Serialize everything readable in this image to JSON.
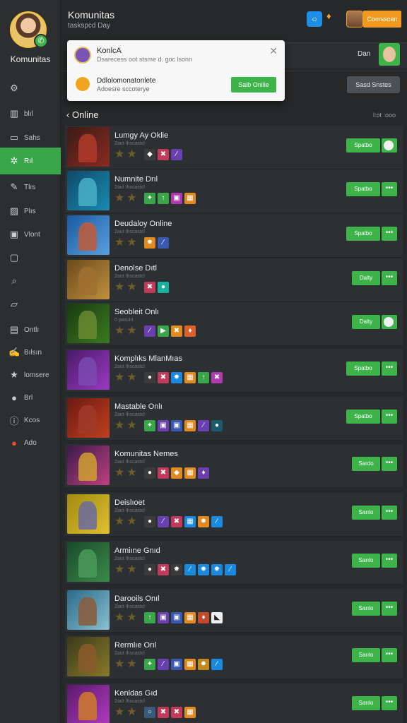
{
  "app": {
    "title": "Komunitas",
    "subtitle": "taskspcd Day",
    "header_action_label": "Comssoan"
  },
  "sidebar": {
    "title": "Komunitas",
    "items": [
      {
        "label": "",
        "icon": "settings-icon"
      },
      {
        "label": "blıl",
        "icon": "chart-icon"
      },
      {
        "label": "Sahs",
        "icon": "window-icon"
      },
      {
        "label": "Rıl",
        "icon": "star-icon",
        "active": true
      },
      {
        "label": "Tlıs",
        "icon": "pen-icon"
      },
      {
        "label": "Plıs",
        "icon": "image-icon"
      },
      {
        "label": "Vlont",
        "icon": "photo-icon"
      },
      {
        "label": "",
        "icon": "frame-icon"
      },
      {
        "label": "",
        "icon": "search-icon"
      },
      {
        "label": "",
        "icon": "book-icon"
      },
      {
        "label": "Ontlı",
        "icon": "folder-icon"
      },
      {
        "label": "Bılsın",
        "icon": "edit-icon"
      },
      {
        "label": "lomsere",
        "icon": "star-outline-icon"
      },
      {
        "label": "Brl",
        "icon": "apple-icon"
      },
      {
        "label": "Kcos",
        "icon": "info-icon"
      },
      {
        "label": "Ado",
        "icon": "orange-circle-icon"
      }
    ]
  },
  "popup": {
    "name1": "KonlcA",
    "text1": "Dsarecess oot stsme d. goc lsonn",
    "name2": "Ddlolomonatonlete",
    "text2": "Adoesre sccoterye",
    "button": "Saib Onilie"
  },
  "right_header": {
    "name": "Dan",
    "send_button": "Sasd Snstes"
  },
  "section": {
    "title": "Online",
    "count": "l:ot :ooo"
  },
  "games": [
    {
      "name": "Lumgy Ay Oklie",
      "sub": "2aut Ihscastcl",
      "colors": [
        "#3a1c16",
        "#8a2a22"
      ],
      "fig": "#b03a2a",
      "badges": [
        {
          "c": "#3b3b3b",
          "g": "◆"
        },
        {
          "c": "#c23a5a",
          "g": "✖"
        },
        {
          "c": "#6a3fb0",
          "g": "⁄"
        }
      ],
      "action": "Spatbo",
      "toggle": true
    },
    {
      "name": "Numnite Drıl",
      "sub": "2aut Ihscastcl",
      "colors": [
        "#0f4a6a",
        "#1a8ab0"
      ],
      "fig": "#4ab0c8",
      "badges": [
        {
          "c": "#3aa64a",
          "g": "✦"
        },
        {
          "c": "#3aa64a",
          "g": "↑"
        },
        {
          "c": "#b03ab0",
          "g": "▣"
        },
        {
          "c": "#e08a20",
          "g": "▦"
        }
      ],
      "action": "Spatbo",
      "toggle": false
    },
    {
      "name": "Deudaloy Online",
      "sub": "2aut Ihscastcl",
      "colors": [
        "#1a5aa0",
        "#5aa0e0"
      ],
      "fig": "#c25a3a",
      "badges": [
        {
          "c": "#e08a20",
          "g": "✸"
        },
        {
          "c": "#3a5ab0",
          "g": "⁄"
        }
      ],
      "action": "Spatbo",
      "toggle": false
    },
    {
      "name": "Denolse Dıtl",
      "sub": "2aut Ihscastcl",
      "colors": [
        "#6a4a1a",
        "#c09040"
      ],
      "fig": "#a07030",
      "badges": [
        {
          "c": "#c23a5a",
          "g": "✖"
        },
        {
          "c": "#1ab0a0",
          "g": "●"
        }
      ],
      "action": "Dalty",
      "toggle": false
    },
    {
      "name": "Seobleit Onlı",
      "sub": "0 pasulıt",
      "colors": [
        "#1a3a10",
        "#3a7a20"
      ],
      "fig": "#6a8a30",
      "badges": [
        {
          "c": "#6a3fb0",
          "g": "⁄"
        },
        {
          "c": "#3aa64a",
          "g": "▶"
        },
        {
          "c": "#e08a20",
          "g": "✖"
        },
        {
          "c": "#e0602a",
          "g": "♦"
        }
      ],
      "action": "Dalty",
      "toggle": true
    },
    {
      "name": "Komplıks MlanMıas",
      "sub": "2aut Ihscastcl",
      "colors": [
        "#4a1a6a",
        "#9a3ac0"
      ],
      "fig": "#7a4ab0",
      "badges": [
        {
          "c": "#3b3b3b",
          "g": "●"
        },
        {
          "c": "#c23a5a",
          "g": "✖"
        },
        {
          "c": "#1a8ae0",
          "g": "✸"
        },
        {
          "c": "#e08a20",
          "g": "▦"
        },
        {
          "c": "#3aa64a",
          "g": "↑"
        },
        {
          "c": "#b03ab0",
          "g": "✖"
        }
      ],
      "action": "Spatbo",
      "toggle": false
    },
    {
      "name": "Mastable Onlı",
      "sub": "2aut Ihscastcl",
      "colors": [
        "#6a1a10",
        "#c04020"
      ],
      "fig": "#a03a2a",
      "badges": [
        {
          "c": "#3aa64a",
          "g": "✦"
        },
        {
          "c": "#6a3fb0",
          "g": "▣"
        },
        {
          "c": "#3a5ab0",
          "g": "▣"
        },
        {
          "c": "#e08a20",
          "g": "▦"
        },
        {
          "c": "#6a3fb0",
          "g": "⁄"
        },
        {
          "c": "#1a5a6a",
          "g": "●"
        }
      ],
      "action": "Spatbo",
      "toggle": false
    },
    {
      "name": "Komunitas Nemes",
      "sub": "2aut Ihscastcl",
      "colors": [
        "#3a1a4a",
        "#c04080"
      ],
      "fig": "#d0a030",
      "badges": [
        {
          "c": "#3b3b3b",
          "g": "●"
        },
        {
          "c": "#c23a5a",
          "g": "✖"
        },
        {
          "c": "#e08a20",
          "g": "◆"
        },
        {
          "c": "#e08a20",
          "g": "▦"
        },
        {
          "c": "#6a3fb0",
          "g": "♦"
        }
      ],
      "action": "Sardo",
      "toggle": false
    },
    {
      "name": "Deislıoet",
      "sub": "2aut Ihscastcl",
      "colors": [
        "#a08a10",
        "#e0c030"
      ],
      "fig": "#6a6aa0",
      "badges": [
        {
          "c": "#3b3b3b",
          "g": "●"
        },
        {
          "c": "#6a3fb0",
          "g": "⁄"
        },
        {
          "c": "#c23a5a",
          "g": "✖"
        },
        {
          "c": "#1a8ae0",
          "g": "▦"
        },
        {
          "c": "#e08a20",
          "g": "✸"
        },
        {
          "c": "#1a8ae0",
          "g": "⁄"
        }
      ],
      "action": "Sarılo",
      "toggle": false
    },
    {
      "name": "Armiıne Gnıd",
      "sub": "2aut Ihscastcl",
      "colors": [
        "#1a4a2a",
        "#3a8a4a"
      ],
      "fig": "#4a9a5a",
      "badges": [
        {
          "c": "#3b3b3b",
          "g": "●"
        },
        {
          "c": "#c23a5a",
          "g": "✖"
        },
        {
          "c": "#3b3b3b",
          "g": "✸"
        },
        {
          "c": "#1a8ae0",
          "g": "⁄"
        },
        {
          "c": "#1a8ae0",
          "g": "✸"
        },
        {
          "c": "#1a8ae0",
          "g": "✸"
        },
        {
          "c": "#1a8ae0",
          "g": "⁄"
        }
      ],
      "action": "Sarılo",
      "toggle": false
    },
    {
      "name": "Darooils Onıl",
      "sub": "2aut Ihscastcl",
      "colors": [
        "#2a6a8a",
        "#8ac0d0"
      ],
      "fig": "#8a5a3a",
      "badges": [
        {
          "c": "#3aa64a",
          "g": "↑"
        },
        {
          "c": "#6a3fb0",
          "g": "▣"
        },
        {
          "c": "#3a5ab0",
          "g": "▣"
        },
        {
          "c": "#e08a20",
          "g": "▦"
        },
        {
          "c": "#c04a2a",
          "g": "♦"
        },
        {
          "c": "#eeeeee",
          "g": "◣"
        }
      ],
      "action": "Sarılo",
      "toggle": false
    },
    {
      "name": "Rermlıe Orıl",
      "sub": "2aut Ihscastcl",
      "colors": [
        "#3a3a1a",
        "#8a7a2a"
      ],
      "fig": "#8a5a2a",
      "badges": [
        {
          "c": "#3aa64a",
          "g": "✦"
        },
        {
          "c": "#6a3fb0",
          "g": "⁄"
        },
        {
          "c": "#3a5ab0",
          "g": "▣"
        },
        {
          "c": "#e08a20",
          "g": "▦"
        },
        {
          "c": "#c08a20",
          "g": "✸"
        },
        {
          "c": "#1a8ae0",
          "g": "⁄"
        }
      ],
      "action": "Sarılo",
      "toggle": false
    },
    {
      "name": "Kenldas Gıd",
      "sub": "2aut Ihscastcl",
      "colors": [
        "#5a1a6a",
        "#b03ac0"
      ],
      "fig": "#d07a2a",
      "badges": [
        {
          "c": "#3a5a7a",
          "g": "○"
        },
        {
          "c": "#c23a5a",
          "g": "✖"
        },
        {
          "c": "#c23a5a",
          "g": "✖"
        },
        {
          "c": "#e08a20",
          "g": "▦"
        }
      ],
      "action": "Sarılo",
      "toggle": false
    }
  ]
}
